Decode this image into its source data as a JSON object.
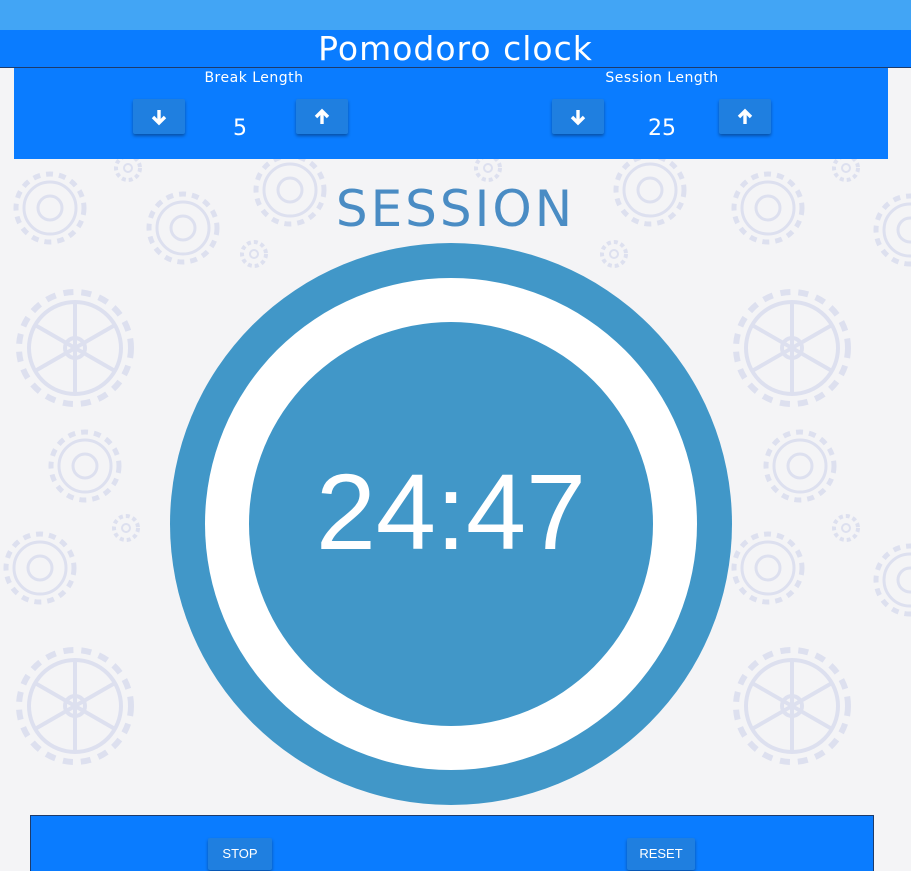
{
  "app": {
    "title": "Pomodoro clock"
  },
  "controls": {
    "break": {
      "label": "Break Length",
      "value": "5"
    },
    "session": {
      "label": "Session Length",
      "value": "25"
    }
  },
  "timer": {
    "status": "SESSION",
    "time": "24:47"
  },
  "actions": {
    "stop_label": "STOP",
    "reset_label": "RESET"
  },
  "colors": {
    "accent": "#0a7cff",
    "clock": "#4197c8",
    "status_text": "#4a8cc4",
    "background": "#f4f4f6"
  },
  "icons": {
    "decrement": "arrow-down-icon",
    "increment": "arrow-up-icon",
    "background": "gear-pattern"
  }
}
